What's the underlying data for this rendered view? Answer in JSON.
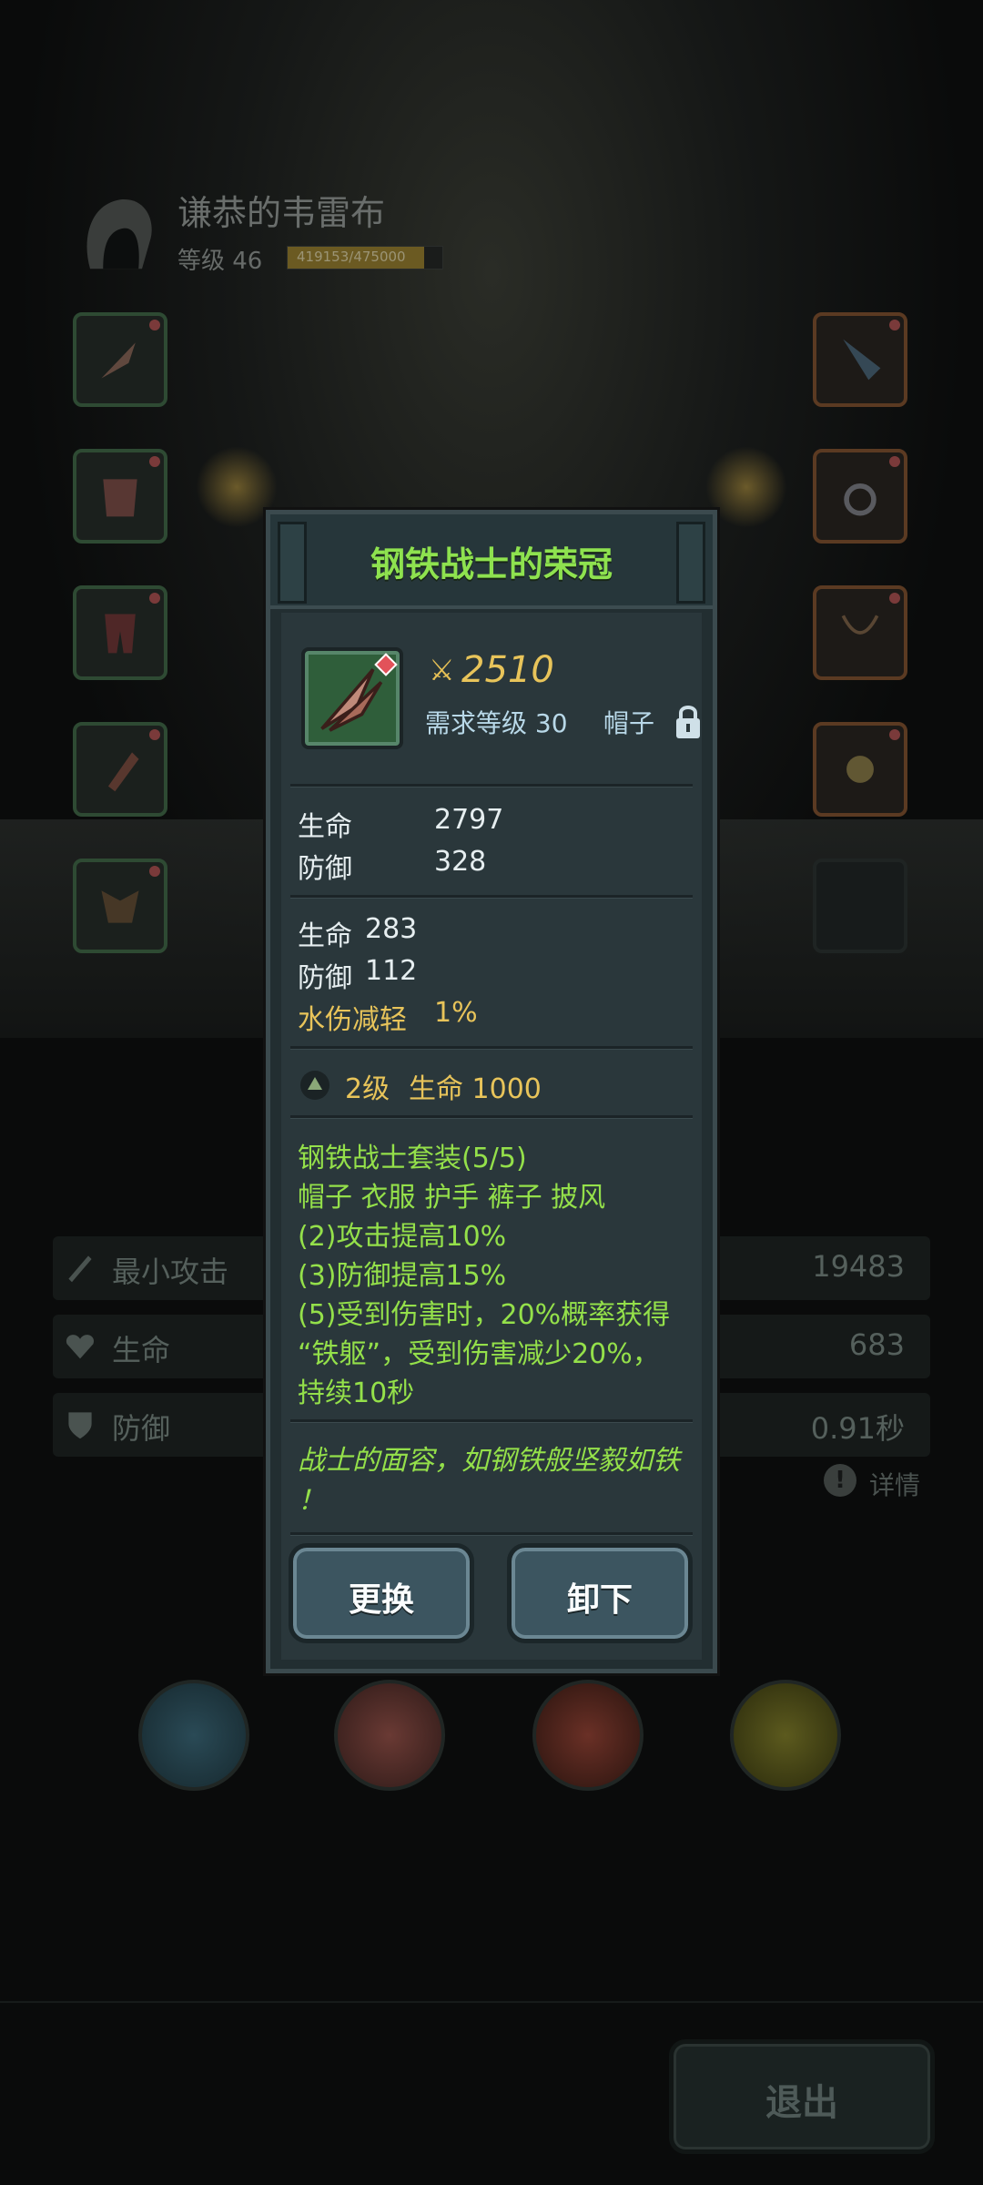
{
  "hero": {
    "name": "谦恭的韦雷布",
    "level_label": "等级 46",
    "exp_text": "419153/475000",
    "exp_progress": 0.88
  },
  "stats": [
    {
      "icon": "sword-icon",
      "label": "最小攻击",
      "value": "19483"
    },
    {
      "icon": "heart-icon",
      "label": "生命",
      "value": "683"
    },
    {
      "icon": "shield-icon",
      "label": "防御",
      "value": "0.91秒"
    }
  ],
  "detail_label": "详情",
  "exit_label": "退出",
  "popup": {
    "title": "钢铁战士的荣冠",
    "power": "2510",
    "requirement": "需求等级 30",
    "part": "帽子",
    "base_stats": [
      {
        "label": "生命",
        "value": "2797"
      },
      {
        "label": "防御",
        "value": "328"
      }
    ],
    "extra_stats": [
      {
        "label": "生命",
        "value": "283"
      },
      {
        "label": "防御",
        "value": "112"
      }
    ],
    "special_stat": {
      "label": "水伤减轻",
      "value": "1%"
    },
    "enchant": {
      "level": "2级",
      "text": "生命 1000"
    },
    "set_bonus": {
      "name": "钢铁战士套装(5/5)",
      "parts": "帽子 衣服 护手 裤子 披风",
      "bonus_2": "(2)攻击提高10%",
      "bonus_3": "(3)防御提高15%",
      "bonus_5_line1": "(5)受到伤害时，20%概率获得",
      "bonus_5_line2": "“铁躯”，受到伤害减少20%，",
      "bonus_5_line3": "持续10秒"
    },
    "flavor_line1": "战士的面容，如钢铁般坚毅如铁",
    "flavor_line2": "！",
    "replace_label": "更换",
    "unequip_label": "卸下"
  },
  "colors": {
    "title_green": "#8ee24f",
    "gold": "#e8c45a",
    "set_green": "#94e04a",
    "req_blue": "#b8d8e8"
  }
}
